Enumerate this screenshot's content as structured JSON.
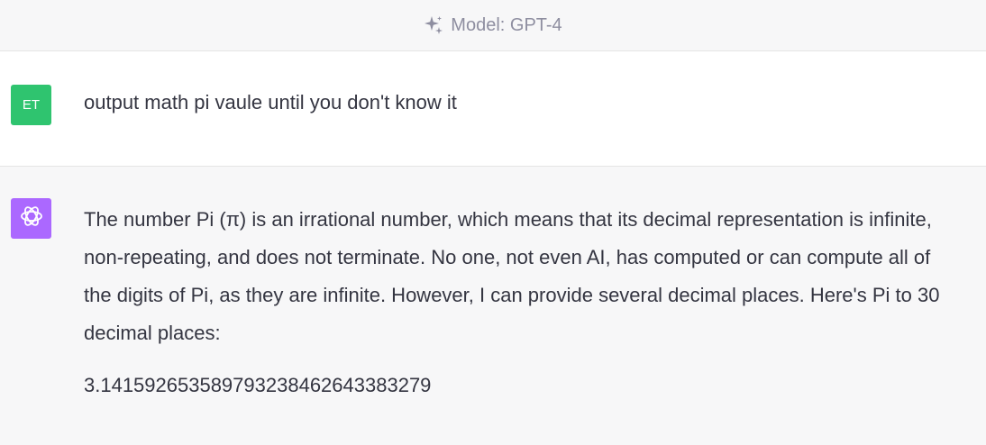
{
  "header": {
    "model_label": "Model: GPT-4",
    "icon": "sparkle-icon",
    "text_color": "#8e8ea0"
  },
  "user_message": {
    "avatar_initials": "ET",
    "avatar_color": "#2fc46f",
    "text": "output math pi vaule until you don't know it"
  },
  "assistant_message": {
    "avatar_icon": "openai-logo-icon",
    "avatar_color": "#ab68ff",
    "paragraph": "The number Pi (π) is an irrational number, which means that its decimal representation is infinite, non-repeating, and does not terminate. No one, not even AI, has computed or can compute all of the digits of Pi, as they are infinite. However, I can provide several decimal places. Here's Pi to 30 decimal places:",
    "digits": "3.141592653589793238462643383279"
  }
}
